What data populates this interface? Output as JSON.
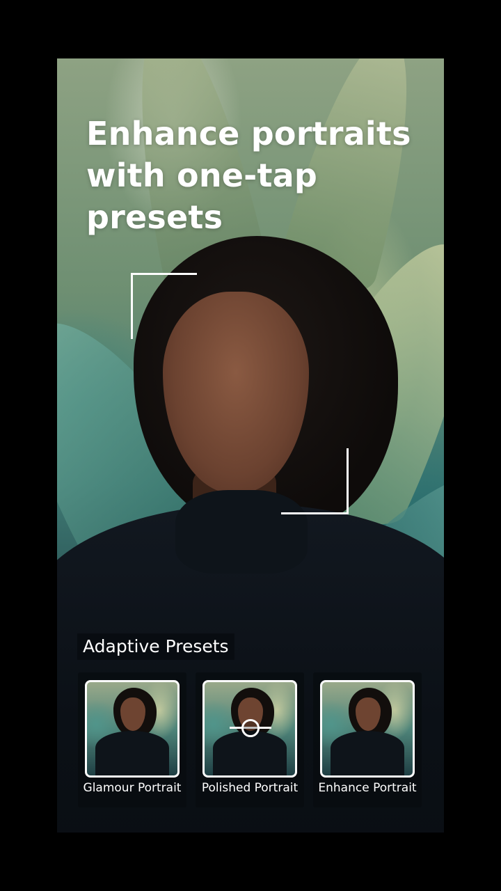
{
  "headline": {
    "line1": "Enhance portraits",
    "line2": "with one-tap presets"
  },
  "presets": {
    "title": "Adaptive Presets",
    "items": [
      {
        "label": "Glamour Portrait"
      },
      {
        "label": "Polished Portrait"
      },
      {
        "label": "Enhance Portrait"
      }
    ]
  },
  "colors": {
    "background": "#000000",
    "text": "#ffffff",
    "panel": "#080c10"
  }
}
